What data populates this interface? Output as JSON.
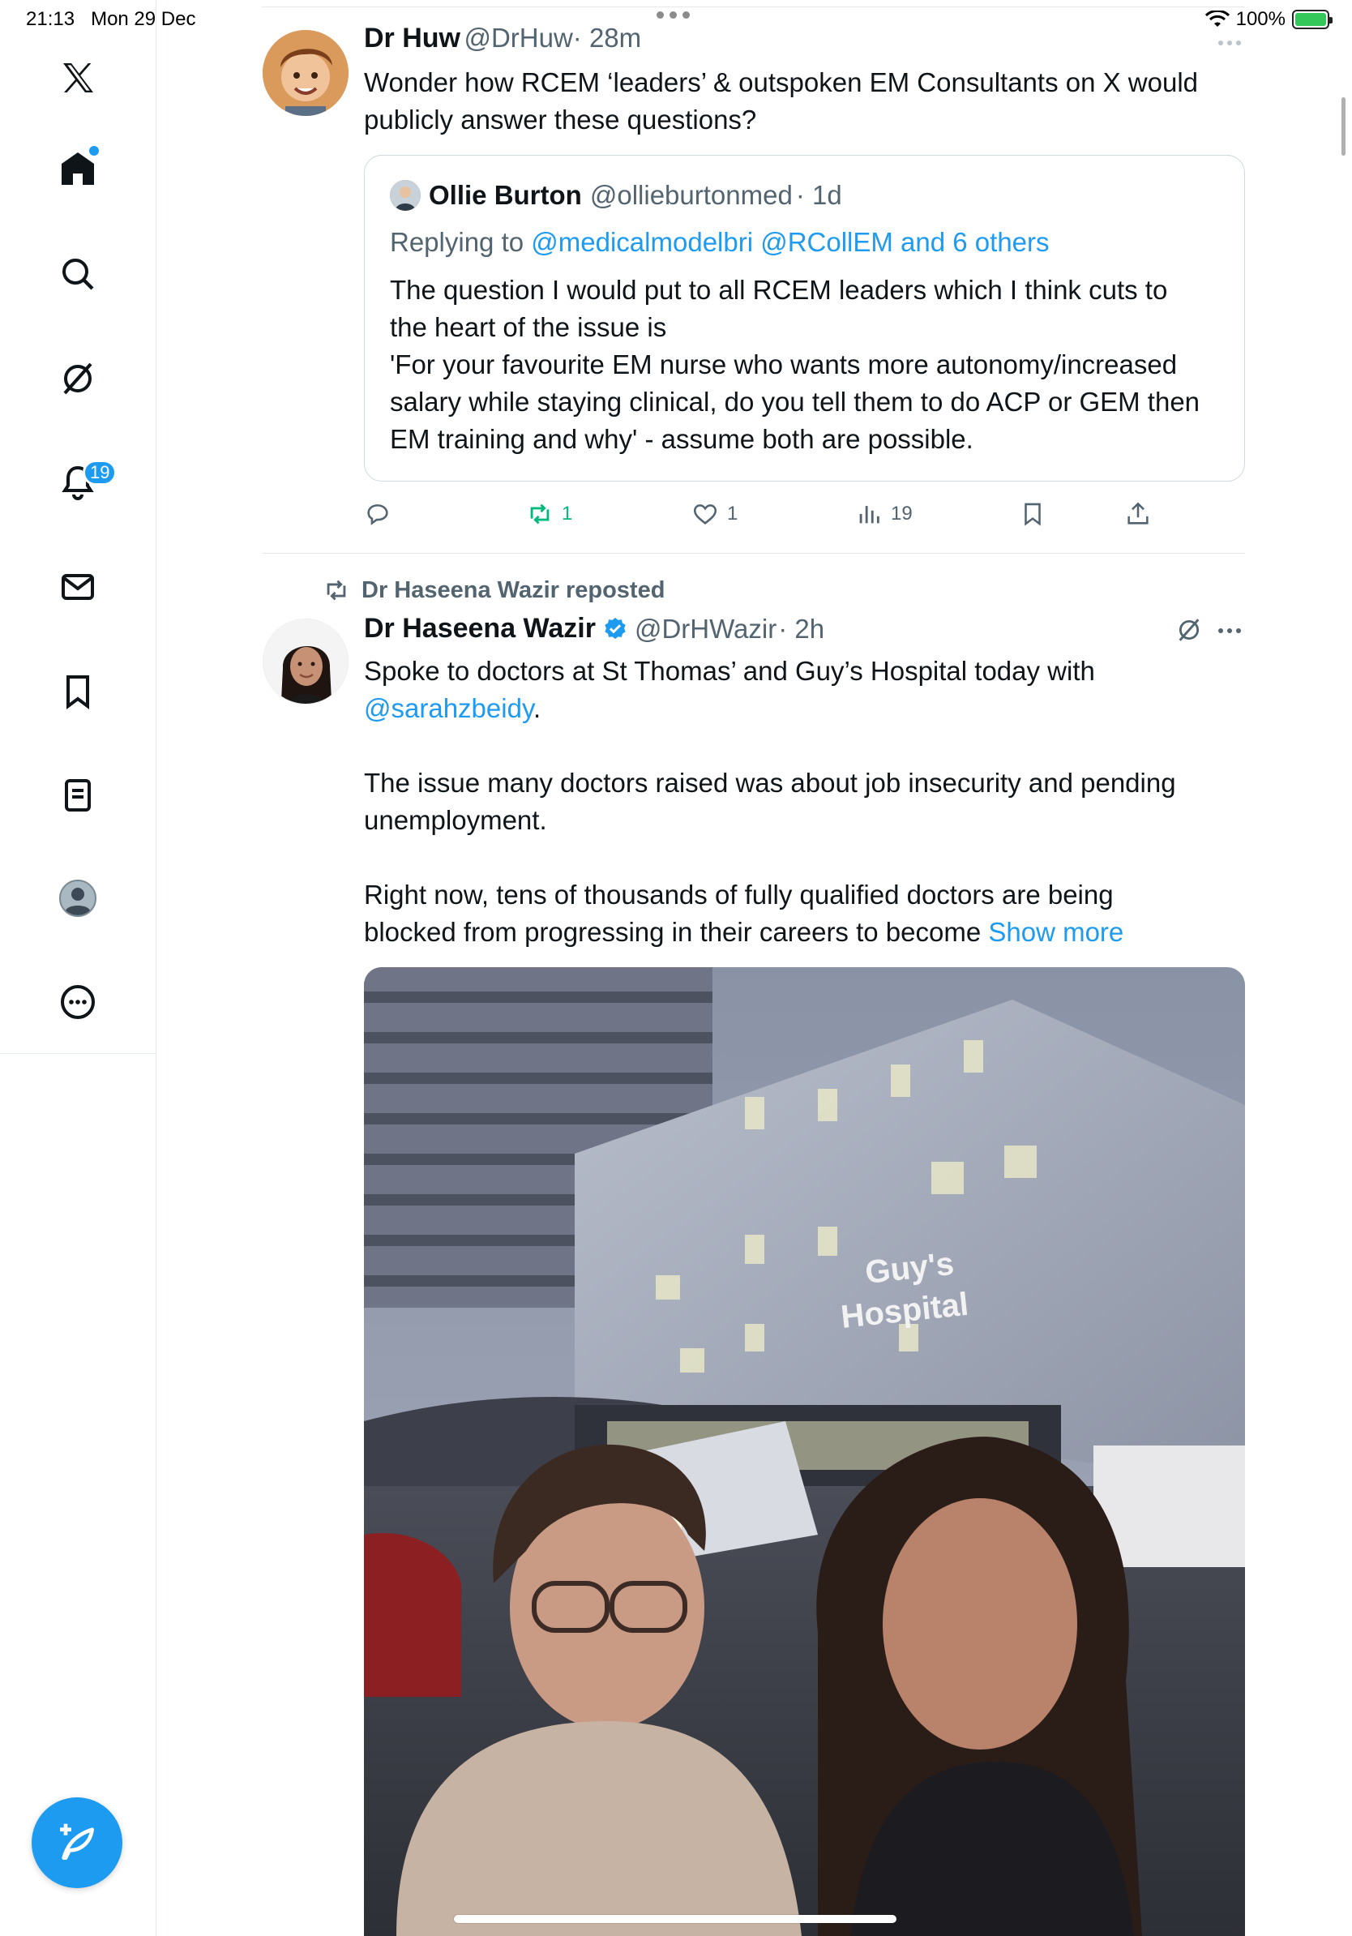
{
  "status_bar": {
    "time": "21:13",
    "date": "Mon 29 Dec",
    "battery": "100%"
  },
  "sidebar": {
    "notifications_badge": "19"
  },
  "tweet1": {
    "name": "Dr Huw",
    "handle": "@DrHuw",
    "time": "· 28m",
    "text_line1": "Wonder how RCEM ‘leaders’ & outspoken EM Consultants on X would",
    "text_line2": "publicly answer these questions?",
    "quote": {
      "name": "Ollie Burton",
      "handle": "@ollieburtonmed",
      "time": "· 1d",
      "replying_prefix": "Replying to",
      "replying_to": "@medicalmodelbri @RCollEM and 6 others",
      "lines": [
        "The question I would put to all RCEM leaders which I think cuts to",
        "the heart of the issue is",
        "'For your favourite EM nurse who wants more autonomy/increased",
        "salary while staying clinical, do you tell them to do ACP or GEM then",
        "EM training and why' - assume both are possible."
      ]
    },
    "reposts": "1",
    "likes": "1",
    "views": "19"
  },
  "tweet2": {
    "repost_label": "Dr Haseena Wazir reposted",
    "name": "Dr Haseena Wazir",
    "handle": "@DrHWazir",
    "time": "· 2h",
    "line1": "Spoke to doctors at St Thomas’ and Guy’s Hospital today with",
    "mention": "@sarahzbeidy",
    "mention_suffix": ".",
    "para2_line1": "The issue many doctors raised was about job insecurity and pending",
    "para2_line2": "unemployment.",
    "para3_line1": "Right now, tens of thousands of fully qualified doctors are being",
    "para3_line2": "blocked from progressing in their careers to become",
    "show_more": "Show more",
    "photo_sign_line1": "Guy's",
    "photo_sign_line2": "Hospital"
  },
  "colors": {
    "accent": "#1d9bf0",
    "repost_green": "#00ba7c",
    "secondary_text": "#536471"
  }
}
